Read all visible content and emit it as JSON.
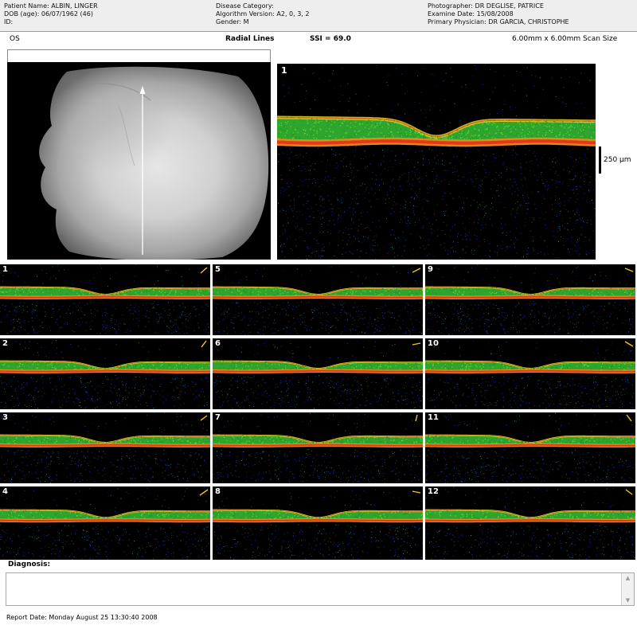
{
  "header": {
    "patient_name": "Patient Name: ALBIN, LINGER",
    "dob": "DOB (age): 06/07/1962 (46)",
    "id": "ID:",
    "disease_category": "Disease Category:",
    "algorithm_version": "Algorithm Version: A2, 0, 3, 2",
    "gender": "Gender: M",
    "photographer": "Photographer: DR DEGLISE, PATRICE",
    "exam_date": "Examine Date: 15/08/2008",
    "physician": "Primary Physician: DR GARCIA, CHRISTOPHE"
  },
  "scan": {
    "eye": "OS",
    "protocol": "Radial Lines",
    "ssi": "SSI = 69.0",
    "scan_size": "6.00mm x 6.00mm Scan Size"
  },
  "main_scan": {
    "number": "1",
    "scale_label": "250 μm"
  },
  "scans": [
    {
      "number": "1"
    },
    {
      "number": "5"
    },
    {
      "number": "9"
    },
    {
      "number": "2"
    },
    {
      "number": "6"
    },
    {
      "number": "10"
    },
    {
      "number": "3"
    },
    {
      "number": "7"
    },
    {
      "number": "11"
    },
    {
      "number": "4"
    },
    {
      "number": "8"
    },
    {
      "number": "12"
    }
  ],
  "diagnosis": {
    "label": "Diagnosis:",
    "value": ""
  },
  "report_date": "Report Date: Monday August 25 13:30:40 2008",
  "colors": {
    "retina_green": "#33b833",
    "retina_yellow": "#e8d21c",
    "rpe_red": "#e0361a",
    "rpe_orange": "#f08a1e",
    "noise": "#1b3fcf",
    "arrow": "#f2c81c"
  }
}
